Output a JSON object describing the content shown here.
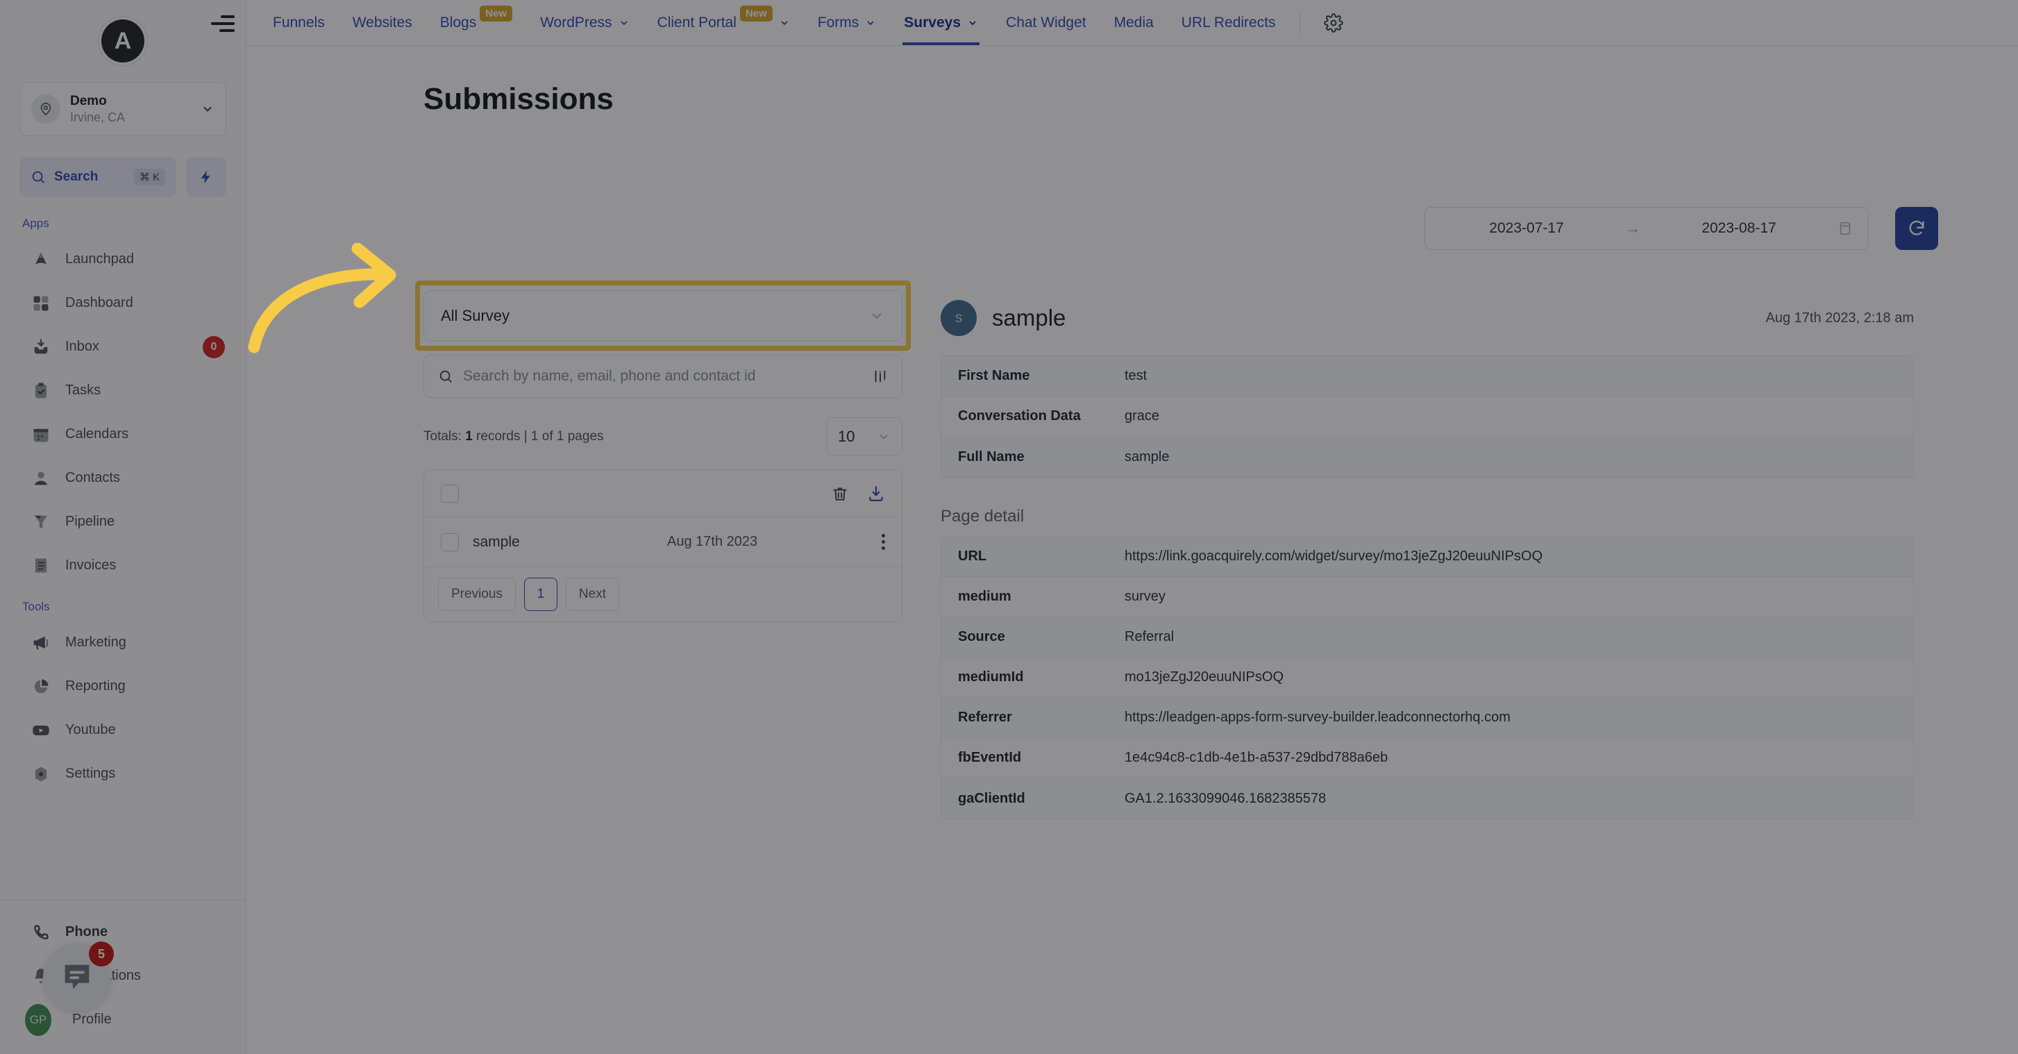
{
  "sidebar": {
    "logo_letter": "A",
    "location": {
      "name": "Demo",
      "sub": "Irvine, CA"
    },
    "search": {
      "label": "Search",
      "shortcut": "⌘ K"
    },
    "sections": [
      {
        "label": "Apps",
        "items": [
          {
            "label": "Launchpad",
            "icon": "launchpad-icon",
            "badge": ""
          },
          {
            "label": "Dashboard",
            "icon": "dashboard-icon",
            "badge": ""
          },
          {
            "label": "Inbox",
            "icon": "inbox-icon",
            "badge": "0"
          },
          {
            "label": "Tasks",
            "icon": "tasks-icon",
            "badge": ""
          },
          {
            "label": "Calendars",
            "icon": "calendar-icon",
            "badge": ""
          },
          {
            "label": "Contacts",
            "icon": "contacts-icon",
            "badge": ""
          },
          {
            "label": "Pipeline",
            "icon": "pipeline-icon",
            "badge": ""
          },
          {
            "label": "Invoices",
            "icon": "invoices-icon",
            "badge": ""
          }
        ]
      },
      {
        "label": "Tools",
        "items": [
          {
            "label": "Marketing",
            "icon": "megaphone-icon",
            "badge": ""
          },
          {
            "label": "Reporting",
            "icon": "pie-chart-icon",
            "badge": ""
          },
          {
            "label": "Youtube",
            "icon": "youtube-icon",
            "badge": ""
          },
          {
            "label": "Settings",
            "icon": "gear-icon",
            "badge": ""
          }
        ]
      }
    ],
    "bottom": [
      {
        "label": "Phone",
        "icon": "phone-icon",
        "badge": ""
      },
      {
        "label": "Notifications",
        "icon": "bell-icon",
        "badge": ""
      },
      {
        "label": "Profile",
        "icon": "avatar-icon",
        "badge": "",
        "avatar_initials": "GP"
      }
    ],
    "chat_widget": {
      "badge": "5"
    }
  },
  "topnav": {
    "items": [
      {
        "label": "Funnels",
        "new": false,
        "caret": false,
        "active": false
      },
      {
        "label": "Websites",
        "new": false,
        "caret": false,
        "active": false
      },
      {
        "label": "Blogs",
        "new": true,
        "new_label": "New",
        "caret": false,
        "active": false
      },
      {
        "label": "WordPress",
        "new": false,
        "caret": true,
        "active": false
      },
      {
        "label": "Client Portal",
        "new": true,
        "new_label": "New",
        "caret": true,
        "active": false
      },
      {
        "label": "Forms",
        "new": false,
        "caret": true,
        "active": false
      },
      {
        "label": "Surveys",
        "new": false,
        "caret": true,
        "active": true
      },
      {
        "label": "Chat Widget",
        "new": false,
        "caret": false,
        "active": false
      },
      {
        "label": "Media",
        "new": false,
        "caret": false,
        "active": false
      },
      {
        "label": "URL Redirects",
        "new": false,
        "caret": false,
        "active": false
      }
    ]
  },
  "main": {
    "title": "Submissions",
    "date_range": {
      "start": "2023-07-17",
      "end": "2023-08-17",
      "arrow": "→"
    },
    "survey_filter": {
      "value": "All Survey"
    },
    "search": {
      "placeholder": "Search by name, email, phone and contact id"
    },
    "totals": {
      "prefix": "Totals: ",
      "count": "1",
      "middle": " records | ",
      "pages": "1 of 1 pages"
    },
    "page_size": {
      "value": "10"
    },
    "pagination": {
      "previous": "Previous",
      "current": "1",
      "next": "Next"
    },
    "rows": [
      {
        "name": "sample",
        "date": "Aug 17th 2023"
      }
    ]
  },
  "detail": {
    "avatar_initial": "s",
    "name": "sample",
    "timestamp": "Aug 17th 2023, 2:18 am",
    "fields": [
      {
        "key": "First Name",
        "value": "test"
      },
      {
        "key": "Conversation Data",
        "value": "grace"
      },
      {
        "key": "Full Name",
        "value": "sample"
      }
    ],
    "page_detail_title": "Page detail",
    "page_detail": [
      {
        "key": "URL",
        "value": "https://link.goacquirely.com/widget/survey/mo13jeZgJ20euuNIPsOQ"
      },
      {
        "key": "medium",
        "value": "survey"
      },
      {
        "key": "Source",
        "value": "Referral"
      },
      {
        "key": "mediumId",
        "value": "mo13jeZgJ20euuNIPsOQ"
      },
      {
        "key": "Referrer",
        "value": "https://leadgen-apps-form-survey-builder.leadconnectorhq.com"
      },
      {
        "key": "fbEventId",
        "value": "1e4c94c8-c1db-4e1b-a537-29dbd788a6eb"
      },
      {
        "key": "gaClientId",
        "value": "GA1.2.1633099046.1682385578"
      }
    ]
  },
  "colors": {
    "accent_blue": "#2f49b0",
    "primary_button": "#22409a",
    "highlight_yellow": "#f8cb47",
    "badge_red": "#d32020",
    "new_badge": "#d8a429"
  }
}
